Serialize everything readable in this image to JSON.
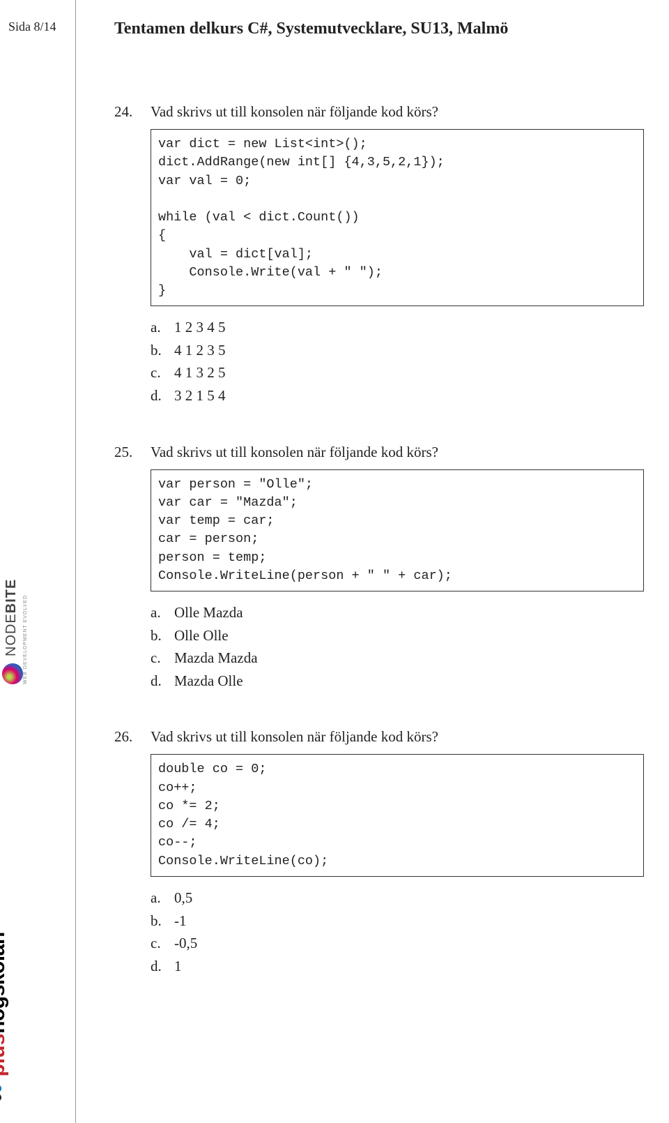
{
  "page_label": "Sida 8/14",
  "title": "Tentamen delkurs C#, Systemutvecklare, SU13, Malmö",
  "questions": [
    {
      "number": "24.",
      "text": "Vad skrivs ut till konsolen när följande kod körs?",
      "code": "var dict = new List<int>();\ndict.AddRange(new int[] {4,3,5,2,1});\nvar val = 0;\n\nwhile (val < dict.Count())\n{\n    val = dict[val];\n    Console.Write(val + \" \");\n}",
      "options": [
        {
          "letter": "a.",
          "text": "1 2 3 4 5"
        },
        {
          "letter": "b.",
          "text": "4 1 2 3 5"
        },
        {
          "letter": "c.",
          "text": "4 1 3 2 5"
        },
        {
          "letter": "d.",
          "text": "3 2 1 5 4"
        }
      ]
    },
    {
      "number": "25.",
      "text": "Vad skrivs ut till konsolen när följande kod körs?",
      "code": "var person = \"Olle\";\nvar car = \"Mazda\";\nvar temp = car;\ncar = person;\nperson = temp;\nConsole.WriteLine(person + \" \" + car);",
      "options": [
        {
          "letter": "a.",
          "text": "Olle Mazda"
        },
        {
          "letter": "b.",
          "text": "Olle Olle"
        },
        {
          "letter": "c.",
          "text": "Mazda Mazda"
        },
        {
          "letter": "d.",
          "text": "Mazda Olle"
        }
      ]
    },
    {
      "number": "26.",
      "text": "Vad skrivs ut till konsolen när följande kod körs?",
      "code": "double co = 0;\nco++;\nco *= 2;\nco /= 4;\nco--;\nConsole.WriteLine(co);",
      "options": [
        {
          "letter": "a.",
          "text": "0,5"
        },
        {
          "letter": "b.",
          "text": "-1"
        },
        {
          "letter": "c.",
          "text": "-0,5"
        },
        {
          "letter": "d.",
          "text": "1"
        }
      ]
    }
  ],
  "logos": {
    "plus": "plus",
    "hogskolan": "högskolan",
    "nodebite_main": "NODE",
    "nodebite_suffix": "BITE",
    "nodebite_sub": "WEB DEVELOPMENT EVOLVED"
  }
}
